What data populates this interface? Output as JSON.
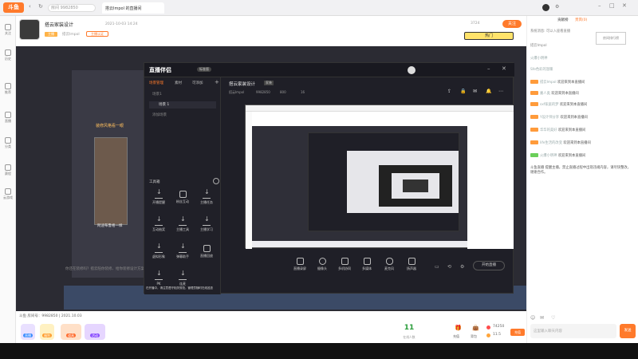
{
  "browser": {
    "logo": "斗鱼",
    "address": "房间 9982850",
    "tab_title": "搭云Impol 的直播间",
    "right_tabs": [
      "贡献榜",
      "贵宾(0)"
    ]
  },
  "sidebar": {
    "items": [
      {
        "label": "关注",
        "icon": "heart-icon"
      },
      {
        "label": "历史",
        "icon": "history-icon"
      },
      {
        "label": "推荐",
        "icon": "home-icon"
      },
      {
        "label": "直播",
        "icon": "live-icon"
      },
      {
        "label": "分类",
        "icon": "grid-icon"
      },
      {
        "label": "赛程",
        "icon": "calendar-icon"
      },
      {
        "label": "云游戏",
        "icon": "gamepad-icon"
      }
    ]
  },
  "room": {
    "title": "搭云家装设计",
    "date": "2021-10-03 14:24",
    "streamer": "搭云Impol",
    "badge": "主播认证",
    "level_tag": "主播",
    "follow_label": "关注",
    "follow_count": "3724",
    "hot_label": "热门"
  },
  "video": {
    "overlay_caption": "装修风格看一眼",
    "side_caption": "阿迪布鲁格一样",
    "bottom_text": "你还在装修吗？搭云陪你装修、给你装修设计方案"
  },
  "companion": {
    "app_name": "直播伴侣",
    "version": "标准版",
    "tabs": [
      "场景管理",
      "素材",
      "可添加"
    ],
    "scene_items": [
      "场景1",
      "场景 1",
      "添加场景"
    ],
    "toolbox_label": "工具箱",
    "tools_row1": [
      "开播提醒",
      "粉丝互动",
      "主播任务"
    ],
    "tools_row2": [
      "互动抽奖",
      "主播工具",
      "主播学习"
    ],
    "tools_row3": [
      "虚拟形象",
      "弹幕助手",
      "直播回放"
    ],
    "tools_row4": [
      "PK",
      "连麦"
    ],
    "notice": "在开播中，请注意遵守相关规范，管理员随时在线巡查",
    "room_name": "搭云家装设计",
    "room_tag": "家装",
    "room_meta": [
      "搭云Impol",
      "9982850",
      "800",
      "16"
    ],
    "bottom_buttons": [
      "直播录屏",
      "摄像头",
      "多机协同",
      "多媒体",
      "麦克风",
      "扬声器"
    ],
    "start_button": "开始直播"
  },
  "infobar": {
    "text": "斗鱼 房间号：9982850 | 2021.10.03"
  },
  "gift": {
    "items": [
      "直播",
      "福利",
      "道具",
      "活动"
    ],
    "count": "11",
    "count_label": "在线人数",
    "actions": [
      "充值",
      "背包"
    ],
    "stats": [
      "74250",
      "11.5"
    ],
    "recharge": "充值"
  },
  "chat": {
    "system_notice": "系统消息: 可以入座看直播",
    "pinned": "房间排行榜",
    "streamer_line": "搭云Impol",
    "lines": [
      {
        "level": "",
        "user": "火爆小明神",
        "text": ""
      },
      {
        "level": "",
        "user": "",
        "text": "Sfe色彩的温暖"
      },
      {
        "level": "Lv4",
        "user": "搭云Impol",
        "text": "欢迎来到本直播间"
      },
      {
        "level": "Lv8",
        "user": "嘉人类",
        "text": "欢迎来到本直播间"
      },
      {
        "level": "Lv9",
        "user": "sxf家庭的梦",
        "text": "欢迎来到本直播间"
      },
      {
        "level": "Lv6",
        "user": "Y设计师分享",
        "text": "欢迎来到本直播间"
      },
      {
        "level": "Lv3",
        "user": "华华的美好",
        "text": "欢迎来到本直播间"
      },
      {
        "level": "Lv5",
        "user": "life生活的改变",
        "text": "欢迎来到本直播间"
      },
      {
        "level": "Lv2",
        "user": "火爆小明神",
        "text": "欢迎来到本直播间"
      }
    ],
    "warning": "斗鱼直播 提醒主播，禁止直播过程中出现违规内容，请尽快整改，谢谢合作。",
    "input_placeholder": "这里输入聊天内容",
    "send_label": "发送"
  },
  "colors": {
    "accent": "#ff7a2b",
    "dark_panel": "#1f1f27",
    "bg": "#2b2b33"
  }
}
